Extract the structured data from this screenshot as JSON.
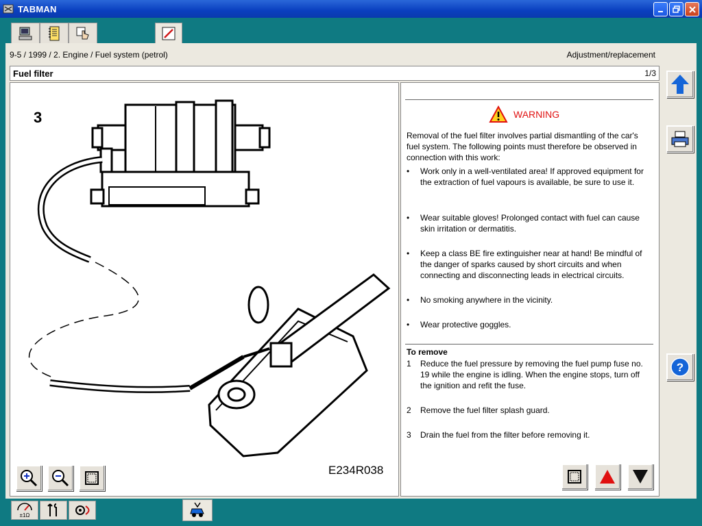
{
  "window": {
    "title": "TABMAN"
  },
  "breadcrumb": {
    "path": "9-5 / 1999 / 2. Engine / Fuel system (petrol)",
    "mode": "Adjustment/replacement"
  },
  "header": {
    "title": "Fuel filter",
    "page": "1/3"
  },
  "figure": {
    "number": "3",
    "code": "E234R038"
  },
  "warning": {
    "label": "WARNING",
    "intro": "Removal of the fuel filter involves partial dismantling of the car's fuel system. The following points must therefore be observed in connection with this work:",
    "bullets": [
      "Work only in a well-ventilated area! If approved equipment for the extraction of fuel vapours is available, be sure to use it.",
      "Wear suitable gloves! Prolonged contact with fuel can cause skin irritation or dermatitis.",
      "Keep a class BE fire extinguisher near at hand! Be mindful of the danger of sparks caused by short circuits and when connecting and disconnecting leads in electrical circuits.",
      "No smoking anywhere in the vicinity.",
      "Wear protective goggles."
    ]
  },
  "procedure": {
    "title": "To remove",
    "steps": [
      {
        "n": "1",
        "text": "Reduce the fuel pressure by removing the fuel pump fuse no. 19 while the engine is idling. When the engine stops, turn off the ignition and refit the fuse."
      },
      {
        "n": "2",
        "text": "Remove the fuel filter splash guard."
      },
      {
        "n": "3",
        "text": "Drain the fuel from the filter before removing it."
      }
    ]
  },
  "colors": {
    "desktop": "#0f7a82",
    "titlebar": "#0a3fbf",
    "warning_red": "#e01010",
    "accent_blue": "#1565d8"
  },
  "icons": {
    "top_tabs": [
      "computer-icon",
      "notebook-icon",
      "hand-pointer-icon",
      "pencil-edit-icon"
    ],
    "bottom_tabs": [
      "multimeter-icon",
      "wrench-icon",
      "diagnostic-icon",
      "car-service-icon"
    ],
    "sidebar": [
      "arrow-up-icon",
      "printer-icon",
      "help-icon"
    ]
  }
}
